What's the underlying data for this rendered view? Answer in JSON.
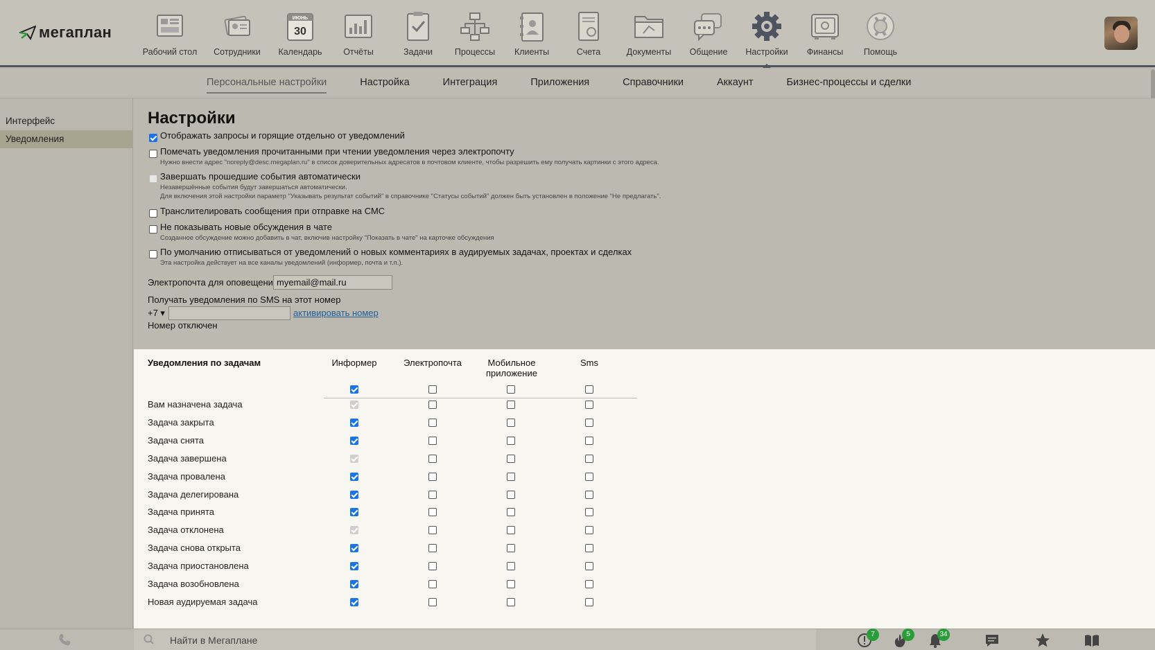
{
  "app": {
    "logo_text": "мегаплан"
  },
  "nav": [
    {
      "label": "Рабочий стол",
      "icon": "desktop-icon"
    },
    {
      "label": "Сотрудники",
      "icon": "employees-icon"
    },
    {
      "label": "Календарь",
      "icon": "calendar-icon",
      "cal_month": "ИЮНЬ",
      "cal_day": "30"
    },
    {
      "label": "Отчёты",
      "icon": "reports-icon"
    },
    {
      "label": "Задачи",
      "icon": "tasks-icon"
    },
    {
      "label": "Процессы",
      "icon": "processes-icon"
    },
    {
      "label": "Клиенты",
      "icon": "clients-icon"
    },
    {
      "label": "Счета",
      "icon": "invoices-icon"
    },
    {
      "label": "Документы",
      "icon": "documents-icon"
    },
    {
      "label": "Общение",
      "icon": "chat-icon"
    },
    {
      "label": "Настройки",
      "icon": "settings-gear-icon",
      "active": true
    },
    {
      "label": "Финансы",
      "icon": "finance-safe-icon"
    },
    {
      "label": "Помощь",
      "icon": "help-lifebuoy-icon"
    }
  ],
  "subnav": [
    {
      "label": "Персональные настройки",
      "active": true
    },
    {
      "label": "Настройка"
    },
    {
      "label": "Интеграция"
    },
    {
      "label": "Приложения"
    },
    {
      "label": "Справочники"
    },
    {
      "label": "Аккаунт"
    },
    {
      "label": "Бизнес-процессы и сделки"
    }
  ],
  "sidebar": {
    "items": [
      {
        "label": "Интерфейс"
      },
      {
        "label": "Уведомления",
        "active": true
      }
    ]
  },
  "page": {
    "title": "Настройки"
  },
  "options": [
    {
      "label": "Отображать запросы и горящие отдельно от уведомлений",
      "state": "checked",
      "hints": []
    },
    {
      "label": "Помечать уведомления прочитанными при чтении уведомления через электропочту",
      "state": "unchecked",
      "hints": [
        "Нужно внести адрес \"noreply@desc.megaplan.ru\" в список доверительных адресатов в почтовом клиенте, чтобы разрешить ему получать картинки с этого адреса."
      ]
    },
    {
      "label": "Завершать прошедшие события автоматически",
      "state": "disabled",
      "hints": [
        "Незавершённые события будут завершаться автоматически.",
        "Для включения этой настройки параметр \"Указывать результат событий\" в справочнике \"Статусы событий\" должен быть установлен в положение \"Не предлагать\"."
      ]
    },
    {
      "label": "Транслителировать сообщения при отправке на СМС",
      "state": "unchecked",
      "hints": []
    },
    {
      "label": "Не показывать новые обсуждения в чате",
      "state": "unchecked",
      "hints": [
        "Созданное обсуждение можно добавить в чат, включив настройку \"Показать в чате\" на карточке обсуждения"
      ]
    },
    {
      "label": "По умолчанию отписываться от уведомлений о новых комментариях в аудируемых задачах, проектах и сделках",
      "state": "unchecked",
      "hints": [
        "Эта настройка действует на все каналы уведомлений (информер, почта и т.п.)."
      ]
    }
  ],
  "email": {
    "label": "Электропочта для оповещений",
    "value": "myemail@mail.ru"
  },
  "sms": {
    "title": "Получать уведомления по SMS на этот номер",
    "prefix": "+7 ▾",
    "value": "",
    "activate_link": "активировать номер",
    "status": "Номер отключен"
  },
  "table": {
    "title": "Уведомления по задачам",
    "columns": [
      "Информер",
      "Электропочта",
      "Мобильное приложение",
      "Sms"
    ],
    "header_row": [
      "checked",
      "unchecked",
      "unchecked",
      "unchecked"
    ],
    "rows": [
      {
        "label": "Вам назначена задача",
        "cells": [
          "dison",
          "unchecked",
          "unchecked",
          "unchecked"
        ]
      },
      {
        "label": "Задача закрыта",
        "cells": [
          "checked",
          "unchecked",
          "unchecked",
          "unchecked"
        ]
      },
      {
        "label": "Задача снята",
        "cells": [
          "checked",
          "unchecked",
          "unchecked",
          "unchecked"
        ]
      },
      {
        "label": "Задача завершена",
        "cells": [
          "dison",
          "unchecked",
          "unchecked",
          "unchecked"
        ]
      },
      {
        "label": "Задача провалена",
        "cells": [
          "checked",
          "unchecked",
          "unchecked",
          "unchecked"
        ]
      },
      {
        "label": "Задача делегирована",
        "cells": [
          "checked",
          "unchecked",
          "unchecked",
          "unchecked"
        ]
      },
      {
        "label": "Задача принята",
        "cells": [
          "checked",
          "unchecked",
          "unchecked",
          "unchecked"
        ]
      },
      {
        "label": "Задача отклонена",
        "cells": [
          "dison",
          "unchecked",
          "unchecked",
          "unchecked"
        ]
      },
      {
        "label": "Задача снова открыта",
        "cells": [
          "checked",
          "unchecked",
          "unchecked",
          "unchecked"
        ]
      },
      {
        "label": "Задача приостановлена",
        "cells": [
          "checked",
          "unchecked",
          "unchecked",
          "unchecked"
        ]
      },
      {
        "label": "Задача возобновлена",
        "cells": [
          "checked",
          "unchecked",
          "unchecked",
          "unchecked"
        ]
      },
      {
        "label": "Новая аудируемая задача",
        "cells": [
          "checked",
          "unchecked",
          "unchecked",
          "unchecked"
        ]
      }
    ]
  },
  "bottombar": {
    "search_placeholder": "Найти в Мегаплане",
    "badges": [
      {
        "icon": "alert-icon",
        "count": "7"
      },
      {
        "icon": "fire-icon",
        "count": "5"
      },
      {
        "icon": "bell-icon",
        "count": "34"
      },
      {
        "icon": "message-icon"
      },
      {
        "icon": "star-icon"
      },
      {
        "icon": "book-icon"
      }
    ]
  },
  "colors": {
    "accent": "#1a73e8",
    "badge": "#2a9d3a",
    "link": "#1f5d9a"
  }
}
